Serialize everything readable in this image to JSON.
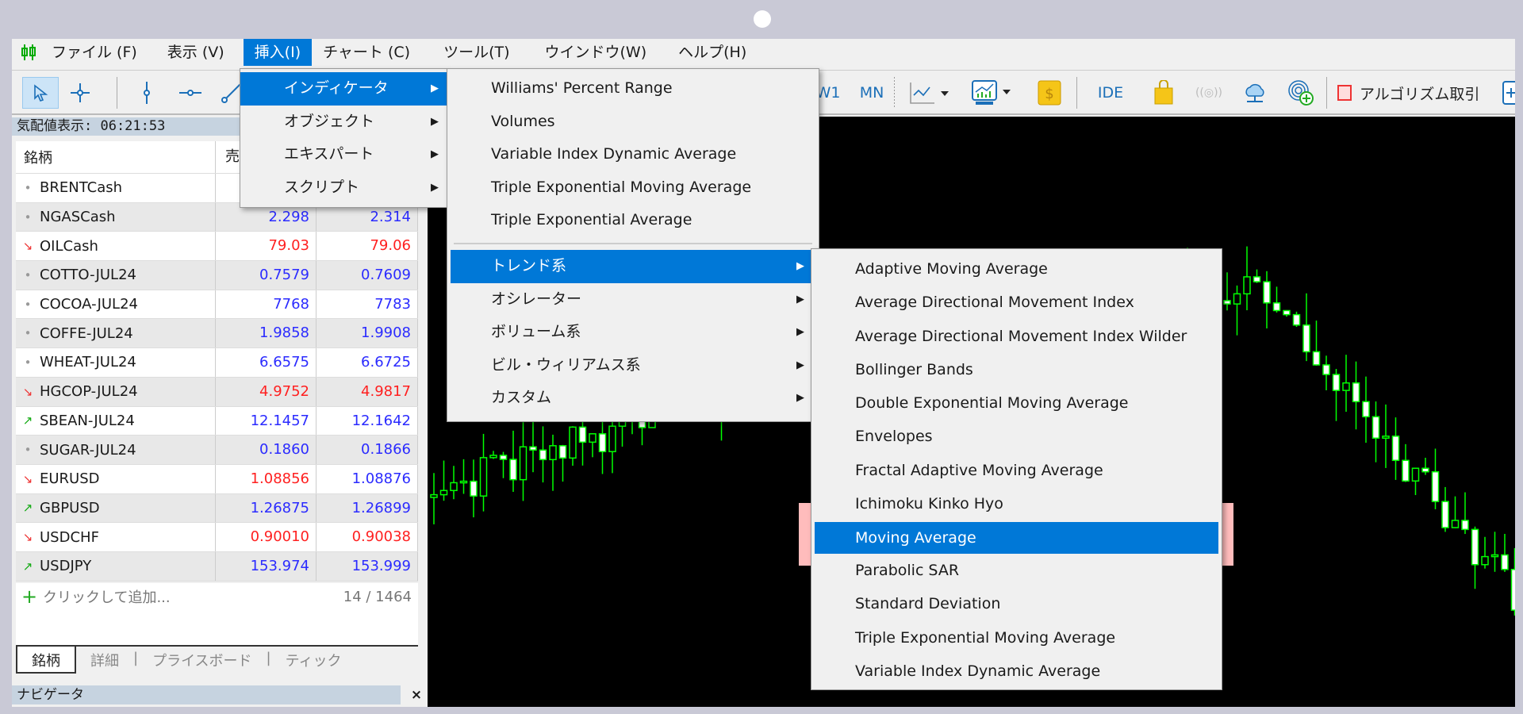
{
  "menubar": {
    "items": [
      "ファイル (F)",
      "表示 (V)",
      "挿入(I)",
      "チャート (C)",
      "ツール(T)",
      "ウインドウ(W)",
      "ヘルプ(H)"
    ],
    "active": "挿入(I)"
  },
  "toolbar": {
    "w1": "W1",
    "mn": "MN",
    "ide": "IDE",
    "algo": "アルゴリズム取引"
  },
  "market_watch": {
    "title": "気配値表示: 06:21:53",
    "headers": [
      "銘柄",
      "売"
    ],
    "rows": [
      {
        "symbol": "BRENTCash",
        "trend": "none",
        "bid": "",
        "ask": "",
        "color": ""
      },
      {
        "symbol": "NGASCash",
        "trend": "none",
        "bid": "2.298",
        "ask": "2.314",
        "color": "#2b2bff"
      },
      {
        "symbol": "OILCash",
        "trend": "down",
        "bid": "79.03",
        "ask": "79.06",
        "color": "#ff2020"
      },
      {
        "symbol": "COTTO-JUL24",
        "trend": "none",
        "bid": "0.7579",
        "ask": "0.7609",
        "color": "#2b2bff"
      },
      {
        "symbol": "COCOA-JUL24",
        "trend": "none",
        "bid": "7768",
        "ask": "7783",
        "color": "#2b2bff"
      },
      {
        "symbol": "COFFE-JUL24",
        "trend": "none",
        "bid": "1.9858",
        "ask": "1.9908",
        "color": "#2b2bff"
      },
      {
        "symbol": "WHEAT-JUL24",
        "trend": "none",
        "bid": "6.6575",
        "ask": "6.6725",
        "color": "#2b2bff"
      },
      {
        "symbol": "HGCOP-JUL24",
        "trend": "down",
        "bid": "4.9752",
        "ask": "4.9817",
        "color": "#ff2020"
      },
      {
        "symbol": "SBEAN-JUL24",
        "trend": "up",
        "bid": "12.1457",
        "ask": "12.1642",
        "color": "#2b2bff"
      },
      {
        "symbol": "SUGAR-JUL24",
        "trend": "none",
        "bid": "0.1860",
        "ask": "0.1866",
        "color": "#2b2bff"
      },
      {
        "symbol": "EURUSD",
        "trend": "down",
        "bid": "1.08856",
        "ask": "1.08876",
        "color": "#ff2020",
        "ask_color": "#2b2bff"
      },
      {
        "symbol": "GBPUSD",
        "trend": "up",
        "bid": "1.26875",
        "ask": "1.26899",
        "color": "#2b2bff"
      },
      {
        "symbol": "USDCHF",
        "trend": "down",
        "bid": "0.90010",
        "ask": "0.90038",
        "color": "#ff2020"
      },
      {
        "symbol": "USDJPY",
        "trend": "up",
        "bid": "153.974",
        "ask": "153.999",
        "color": "#2b2bff"
      }
    ],
    "add_label": "クリックして追加...",
    "count": "14 / 1464",
    "tabs": [
      "銘柄",
      "詳細",
      "プライスボード",
      "ティック"
    ]
  },
  "navigator": {
    "title": "ナビゲータ",
    "close": "×"
  },
  "insert_menu": {
    "items": [
      "インディケータ",
      "オブジェクト",
      "エキスパート",
      "スクリプト"
    ]
  },
  "indicator_menu": {
    "items": [
      "Williams' Percent Range",
      "Volumes",
      "Variable Index Dynamic Average",
      "Triple Exponential Moving Average",
      "Triple Exponential Average"
    ],
    "groups": [
      "トレンド系",
      "オシレーター",
      "ボリューム系",
      "ビル・ウィリアムス系",
      "カスタム"
    ]
  },
  "trend_menu": {
    "items": [
      "Adaptive Moving Average",
      "Average Directional Movement Index",
      "Average Directional Movement Index Wilder",
      "Bollinger Bands",
      "Double Exponential Moving Average",
      "Envelopes",
      "Fractal Adaptive Moving Average",
      "Ichimoku Kinko Hyo",
      "Moving Average",
      "Parabolic SAR",
      "Standard Deviation",
      "Triple Exponential Moving Average",
      "Variable Index Dynamic Average"
    ],
    "selected": "Moving Average"
  },
  "colors": {
    "accent": "#0078d7",
    "highlight_box": "#ffbcbc",
    "candle": "#00ff00"
  }
}
